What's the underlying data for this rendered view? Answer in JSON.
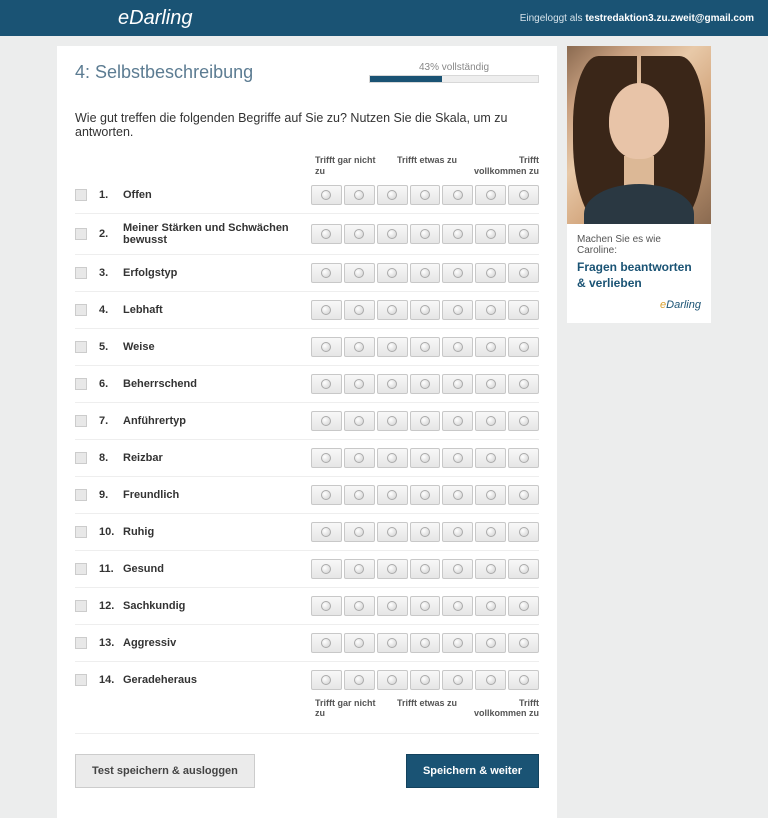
{
  "header": {
    "logo_text": "eDarling",
    "login_prefix": "Eingeloggt als ",
    "login_user": "testredaktion3.zu.zweit@gmail.com"
  },
  "page": {
    "title": "4: Selbstbeschreibung",
    "progress_label": "43% vollständig",
    "progress_pct": 43,
    "intro": "Wie gut treffen die folgenden Begriffe auf Sie zu? Nutzen Sie die Skala, um zu antworten."
  },
  "scale": {
    "left": "Trifft gar nicht zu",
    "mid": "Trifft etwas zu",
    "right": "Trifft vollkommen zu",
    "options": 7
  },
  "questions": [
    {
      "n": "1.",
      "t": "Offen"
    },
    {
      "n": "2.",
      "t": "Meiner Stärken und Schwächen bewusst"
    },
    {
      "n": "3.",
      "t": "Erfolgstyp"
    },
    {
      "n": "4.",
      "t": "Lebhaft"
    },
    {
      "n": "5.",
      "t": "Weise"
    },
    {
      "n": "6.",
      "t": "Beherrschend"
    },
    {
      "n": "7.",
      "t": "Anführertyp"
    },
    {
      "n": "8.",
      "t": "Reizbar"
    },
    {
      "n": "9.",
      "t": "Freundlich"
    },
    {
      "n": "10.",
      "t": "Ruhig"
    },
    {
      "n": "11.",
      "t": "Gesund"
    },
    {
      "n": "12.",
      "t": "Sachkundig"
    },
    {
      "n": "13.",
      "t": "Aggressiv"
    },
    {
      "n": "14.",
      "t": "Geradeheraus"
    }
  ],
  "buttons": {
    "save_logout": "Test speichern & ausloggen",
    "save_next": "Speichern & weiter"
  },
  "sidebar": {
    "line1": "Machen Sie es wie Caroline:",
    "line2": "Fragen beantworten & verlieben",
    "logo": "eDarling"
  }
}
